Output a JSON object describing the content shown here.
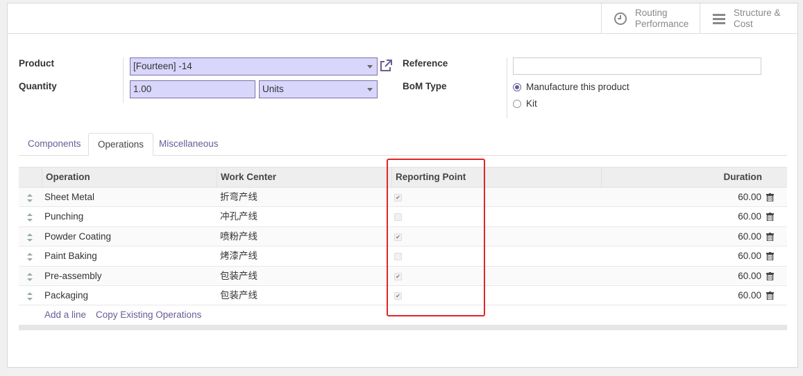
{
  "smart_buttons": [
    {
      "label": "Routing\nPerformance",
      "icon": "clock-icon"
    },
    {
      "label": "Structure &\nCost",
      "icon": "bars-icon"
    }
  ],
  "form": {
    "product_label": "Product",
    "product_value": "[Fourteen] -14",
    "quantity_label": "Quantity",
    "quantity_value": "1.00",
    "uom_value": "Units",
    "reference_label": "Reference",
    "reference_value": "",
    "bom_type_label": "BoM Type",
    "bom_type_options": [
      "Manufacture this product",
      "Kit"
    ],
    "bom_type_selected": "Manufacture this product"
  },
  "tabs": [
    "Components",
    "Operations",
    "Miscellaneous"
  ],
  "active_tab": "Operations",
  "table": {
    "headers": [
      "Operation",
      "Work Center",
      "Reporting Point",
      "Duration"
    ],
    "rows": [
      {
        "operation": "Sheet Metal",
        "work_center": "折弯产线",
        "reporting_point": true,
        "duration": "60.00"
      },
      {
        "operation": "Punching",
        "work_center": "冲孔产线",
        "reporting_point": false,
        "duration": "60.00"
      },
      {
        "operation": "Powder Coating",
        "work_center": "喷粉产线",
        "reporting_point": true,
        "duration": "60.00"
      },
      {
        "operation": "Paint Baking",
        "work_center": "烤漆产线",
        "reporting_point": false,
        "duration": "60.00"
      },
      {
        "operation": "Pre-assembly",
        "work_center": "包装产线",
        "reporting_point": true,
        "duration": "60.00"
      },
      {
        "operation": "Packaging",
        "work_center": "包装产线",
        "reporting_point": true,
        "duration": "60.00"
      }
    ],
    "add_line_label": "Add a line",
    "copy_label": "Copy Existing Operations"
  },
  "colors": {
    "accent": "#6b5b95",
    "highlight": "#e32323",
    "input_bg": "#d9d6fb"
  }
}
